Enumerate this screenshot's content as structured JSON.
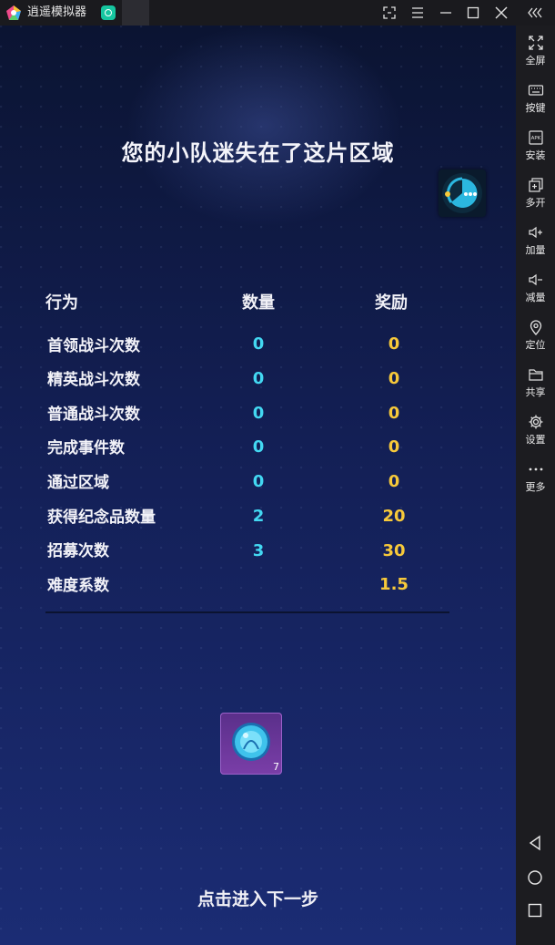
{
  "titlebar": {
    "app_title": "逍遥模拟器",
    "icons": [
      "app-logo-icon",
      "app-tab-icon",
      "screenshot-icon",
      "menu-icon",
      "minimize-icon",
      "maximize-icon",
      "close-icon",
      "collapse-icon"
    ]
  },
  "sidebar": {
    "items": [
      {
        "label": "全屏",
        "icon": "fullscreen-icon"
      },
      {
        "label": "按键",
        "icon": "keyboard-icon"
      },
      {
        "label": "安装",
        "icon": "apk-icon"
      },
      {
        "label": "多开",
        "icon": "multi-instance-icon"
      },
      {
        "label": "加量",
        "icon": "volume-up-icon"
      },
      {
        "label": "减量",
        "icon": "volume-down-icon"
      },
      {
        "label": "定位",
        "icon": "location-icon"
      },
      {
        "label": "共享",
        "icon": "folder-icon"
      },
      {
        "label": "设置",
        "icon": "gear-icon"
      },
      {
        "label": "更多",
        "icon": "more-icon"
      }
    ],
    "nav": [
      "back-icon",
      "home-icon",
      "recents-icon"
    ]
  },
  "game": {
    "title": "您的小队迷失在了这片区域",
    "headers": {
      "action": "行为",
      "quantity": "数量",
      "reward": "奖励"
    },
    "rows": [
      {
        "label": "首领战斗次数",
        "quantity": "0",
        "reward": "0"
      },
      {
        "label": "精英战斗次数",
        "quantity": "0",
        "reward": "0"
      },
      {
        "label": "普通战斗次数",
        "quantity": "0",
        "reward": "0"
      },
      {
        "label": "完成事件数",
        "quantity": "0",
        "reward": "0"
      },
      {
        "label": "通过区域",
        "quantity": "0",
        "reward": "0"
      },
      {
        "label": "获得纪念品数量",
        "quantity": "2",
        "reward": "20"
      },
      {
        "label": "招募次数",
        "quantity": "3",
        "reward": "30"
      },
      {
        "label": "难度系数",
        "quantity": "",
        "reward": "1.5"
      }
    ],
    "item": {
      "count": "7",
      "icon": "crystal-orb-icon"
    },
    "next_step": "点击进入下一步",
    "colors": {
      "quantity": "#43d8f2",
      "reward": "#f7c93a"
    }
  }
}
